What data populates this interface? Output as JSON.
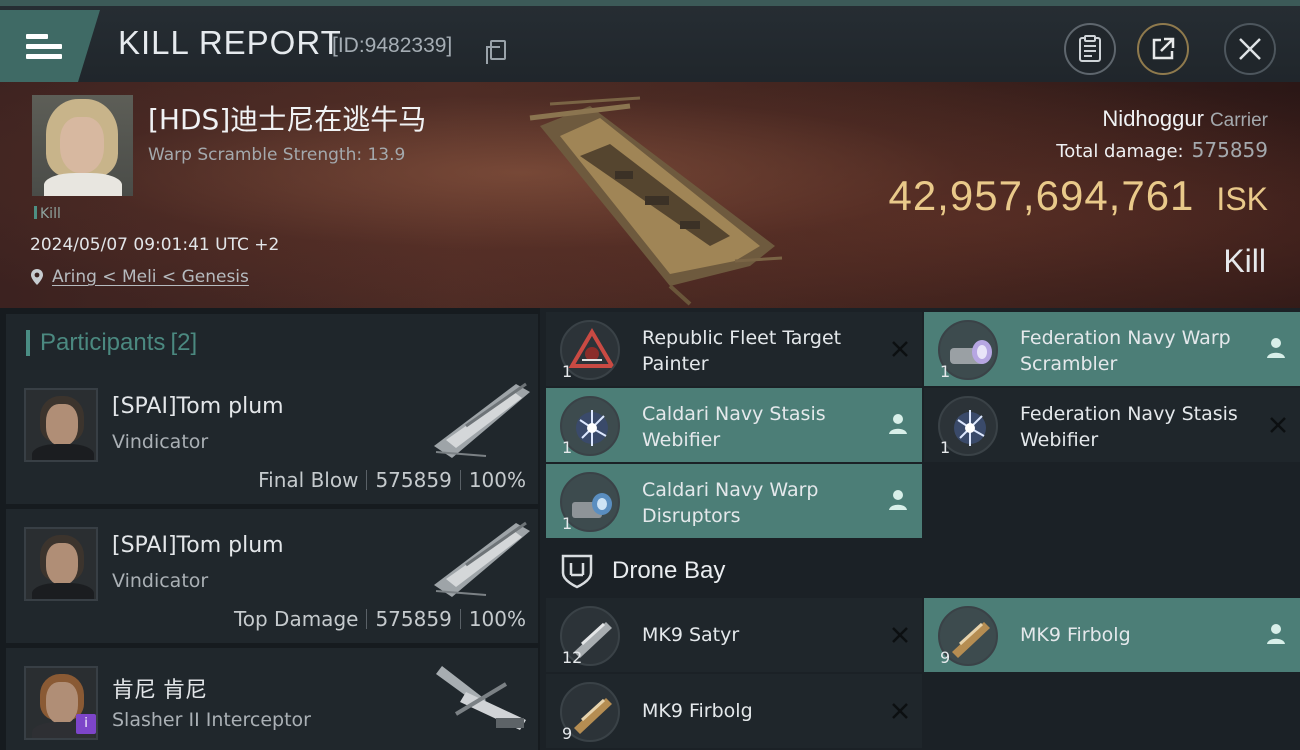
{
  "header": {
    "title": "KILL REPORT",
    "report_id": "[ID:9482339]"
  },
  "victim": {
    "name": "[HDS]迪士尼在逃牛马",
    "warp_scramble": "Warp Scramble Strength: 13.9",
    "tag": "Kill",
    "datetime": "2024/05/07 09:01:41 UTC +2",
    "location": "Aring < Meli < Genesis",
    "ship_name": "Nidhoggur",
    "ship_class": "Carrier",
    "total_damage_label": "Total damage:",
    "total_damage": "575859",
    "isk_value": "42,957,694,761",
    "isk_unit": "ISK",
    "result": "Kill"
  },
  "participants": {
    "title": "Participants",
    "count": "[2]",
    "items": [
      {
        "name": "[SPAI]Tom plum",
        "ship": "Vindicator",
        "role": "Final Blow",
        "damage": "575859",
        "percent": "100%"
      },
      {
        "name": "[SPAI]Tom plum",
        "ship": "Vindicator",
        "role": "Top Damage",
        "damage": "575859",
        "percent": "100%"
      },
      {
        "name": "肯尼 肯尼",
        "ship": "Slasher II Interceptor"
      }
    ]
  },
  "modules": [
    {
      "name": "Republic Fleet Target Painter",
      "qty": "1",
      "state": "destroyed",
      "highlight": false
    },
    {
      "name": "Federation Navy Warp Scrambler",
      "qty": "1",
      "state": "dropped",
      "highlight": true
    },
    {
      "name": "Caldari Navy Stasis Webifier",
      "qty": "1",
      "state": "dropped",
      "highlight": true
    },
    {
      "name": "Federation Navy Stasis Webifier",
      "qty": "1",
      "state": "destroyed",
      "highlight": false
    },
    {
      "name": "Caldari Navy Warp Disruptors",
      "qty": "1",
      "state": "dropped",
      "highlight": true
    }
  ],
  "drone_bay": {
    "title": "Drone Bay",
    "items": [
      {
        "name": "MK9 Satyr",
        "qty": "12",
        "state": "destroyed",
        "highlight": false
      },
      {
        "name": "MK9 Firbolg",
        "qty": "9",
        "state": "dropped",
        "highlight": true
      },
      {
        "name": "MK9 Firbolg",
        "qty": "9",
        "state": "destroyed",
        "highlight": false
      }
    ]
  },
  "colors": {
    "accent_teal": "#4c7e77",
    "isk_gold": "#e9c98a",
    "menu_teal": "#3f6a65"
  }
}
